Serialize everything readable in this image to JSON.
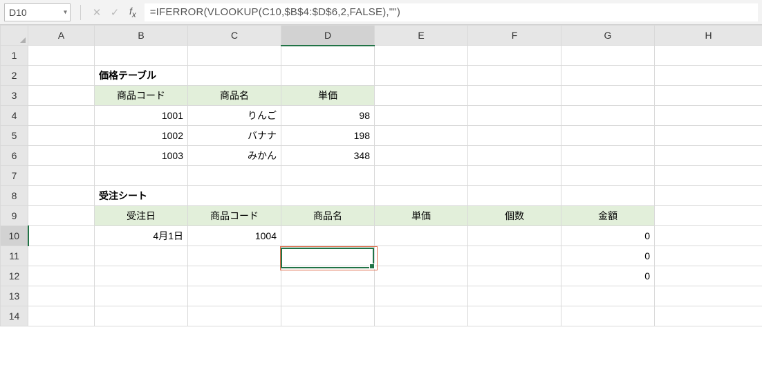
{
  "namebox": {
    "value": "D10"
  },
  "formula": "=IFERROR(VLOOKUP(C10,$B$4:$D$6,2,FALSE),\"\")",
  "columns": [
    "A",
    "B",
    "C",
    "D",
    "E",
    "F",
    "G",
    "H"
  ],
  "rows": [
    "1",
    "2",
    "3",
    "4",
    "5",
    "6",
    "7",
    "8",
    "9",
    "10",
    "11",
    "12",
    "13",
    "14"
  ],
  "activeCol": "D",
  "activeRow": "10",
  "labels": {
    "priceTableTitle": "価格テーブル",
    "priceHeaders": {
      "code": "商品コード",
      "name": "商品名",
      "unitprice": "単価"
    },
    "orderTitle": "受注シート",
    "orderHeaders": {
      "date": "受注日",
      "code": "商品コード",
      "name": "商品名",
      "unitprice": "単価",
      "qty": "個数",
      "amount": "金額"
    }
  },
  "priceTable": [
    {
      "code": "1001",
      "name": "りんご",
      "unitprice": "98"
    },
    {
      "code": "1002",
      "name": "バナナ",
      "unitprice": "198"
    },
    {
      "code": "1003",
      "name": "みかん",
      "unitprice": "348"
    }
  ],
  "orderSheet": [
    {
      "date": "4月1日",
      "code": "1004",
      "name": "",
      "unitprice": "",
      "qty": "",
      "amount": "0"
    },
    {
      "date": "",
      "code": "",
      "name": "",
      "unitprice": "",
      "qty": "",
      "amount": "0"
    },
    {
      "date": "",
      "code": "",
      "name": "",
      "unitprice": "",
      "qty": "",
      "amount": "0"
    }
  ]
}
